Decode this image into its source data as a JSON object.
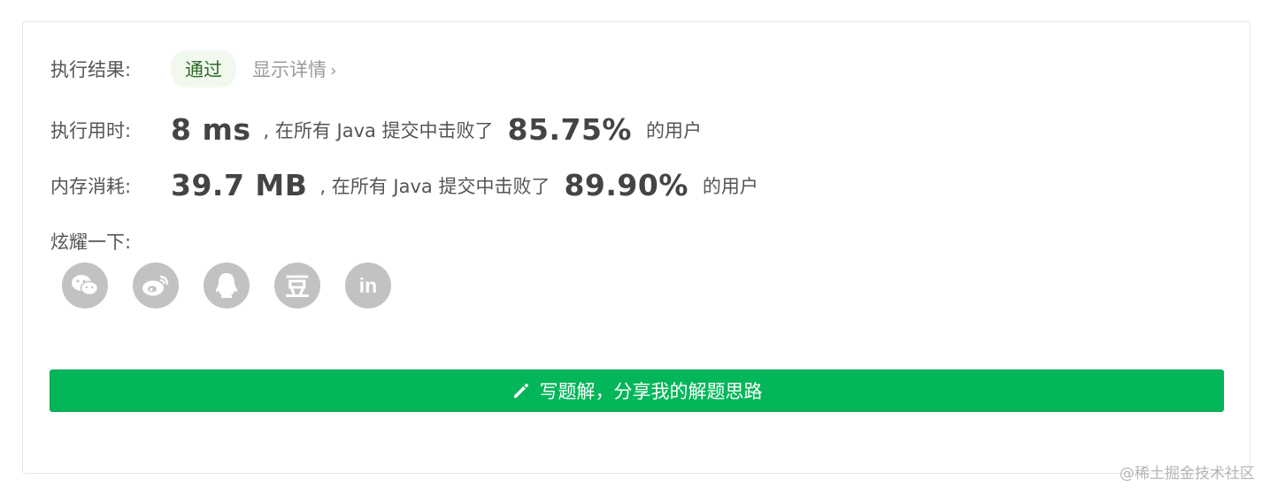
{
  "result": {
    "label": "执行结果:",
    "status": "通过",
    "details_link": "显示详情",
    "details_chevron": "›"
  },
  "runtime": {
    "label": "执行用时:",
    "value": "8 ms",
    "mid_text": ", 在所有 Java 提交中击败了",
    "percent": "85.75%",
    "suffix": "的用户"
  },
  "memory": {
    "label": "内存消耗:",
    "value": "39.7 MB",
    "mid_text": ", 在所有 Java 提交中击败了",
    "percent": "89.90%",
    "suffix": "的用户"
  },
  "share": {
    "label": "炫耀一下:",
    "icons": [
      "wechat-icon",
      "weibo-icon",
      "qq-icon",
      "douban-icon",
      "linkedin-icon"
    ],
    "douban_glyph": "豆",
    "linkedin_glyph": "in"
  },
  "cta": {
    "label": "写题解，分享我的解题思路",
    "icon": "pencil-icon"
  },
  "watermark": "@稀土掘金技术社区",
  "colors": {
    "accent_green": "#02b659",
    "badge_bg": "#f1f9ee",
    "icon_gray": "#c2c2c2"
  }
}
